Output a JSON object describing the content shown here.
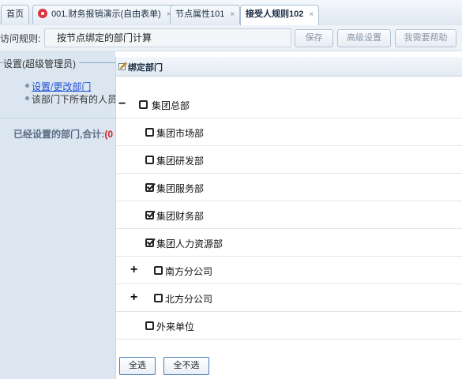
{
  "tabs": [
    {
      "label": "首页",
      "closable": false,
      "active": false,
      "icon": ""
    },
    {
      "label": "001.财务报销演示(自由表单)",
      "closable": true,
      "active": false,
      "icon": "gear-icon"
    },
    {
      "label": "节点属性101",
      "closable": true,
      "active": false,
      "icon": ""
    },
    {
      "label": "接受人规则102",
      "closable": true,
      "active": true,
      "icon": ""
    }
  ],
  "close_glyph": "×",
  "toolbar": {
    "rule_label": "访问规则:",
    "rule_value": "按节点绑定的部门计算",
    "save_label": "保存",
    "advanced_label": "高级设置",
    "help_label": "我需要帮助"
  },
  "left": {
    "fieldset_title": "设置(超级管理员)",
    "link_label": "设置/更改部门",
    "note_text": "该部门下所有的人员",
    "summary_label": "已经设置的部门,合计:",
    "summary_count": "(0"
  },
  "dialog": {
    "title": "绑定部门",
    "nodes": [
      {
        "label": "集团总部",
        "checked": false,
        "expander": "−"
      },
      {
        "label": "集团市场部",
        "checked": false,
        "expander": ""
      },
      {
        "label": "集团研发部",
        "checked": false,
        "expander": ""
      },
      {
        "label": "集团服务部",
        "checked": true,
        "expander": ""
      },
      {
        "label": "集团财务部",
        "checked": true,
        "expander": ""
      },
      {
        "label": "集团人力资源部",
        "checked": true,
        "expander": ""
      },
      {
        "label": "南方分公司",
        "checked": false,
        "expander": "+"
      },
      {
        "label": "北方分公司",
        "checked": false,
        "expander": "+"
      },
      {
        "label": "外来单位",
        "checked": false,
        "expander": ""
      }
    ],
    "select_all_label": "全选",
    "select_none_label": "全不选"
  }
}
